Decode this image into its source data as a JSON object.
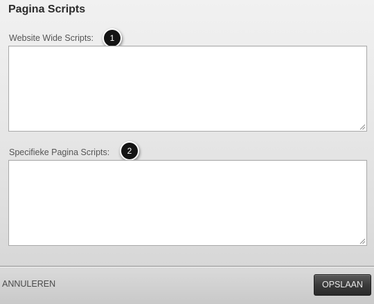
{
  "dialog": {
    "title": "Pagina Scripts"
  },
  "fields": [
    {
      "label": "Website Wide Scripts:",
      "callout": "1",
      "value": ""
    },
    {
      "label": "Specifieke Pagina Scripts:",
      "callout": "2",
      "value": ""
    }
  ],
  "footer": {
    "cancel_label": "ANNULEREN",
    "save_label": "OPSLAAN"
  }
}
